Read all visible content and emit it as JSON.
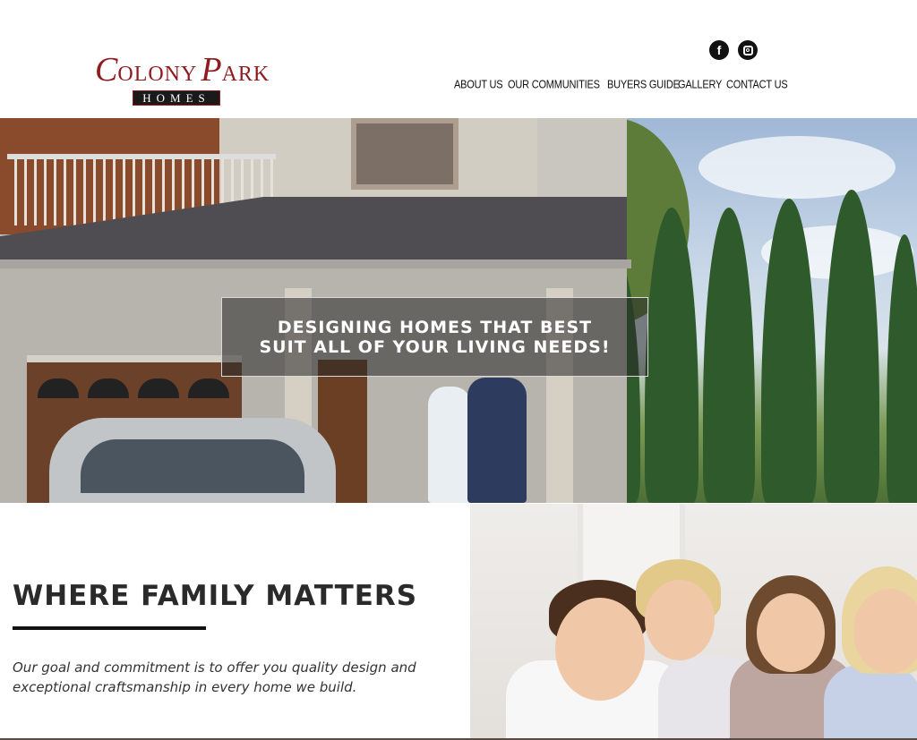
{
  "brand": {
    "logo_line1_big_c": "C",
    "logo_line1_olony": "OLONY",
    "logo_line1_big_p": "P",
    "logo_line1_ark": "ARK",
    "logo_line2": "HOMES",
    "accent_color": "#8e1b1e"
  },
  "social": {
    "facebook_glyph": "f",
    "facebook_icon": "facebook-icon",
    "instagram_icon": "instagram-icon"
  },
  "nav": {
    "items": [
      {
        "label": "ABOUT US"
      },
      {
        "label": "OUR COMMUNITIES"
      },
      {
        "label": "BUYERS GUIDE"
      },
      {
        "label": "GALLERY"
      },
      {
        "label": "CONTACT US"
      }
    ]
  },
  "hero": {
    "line1": "DESIGNING HOMES THAT BEST",
    "line2": "SUIT ALL OF YOUR LIVING NEEDS!"
  },
  "family": {
    "title": "WHERE FAMILY MATTERS",
    "text": "Our goal and commitment is to offer you quality design and exceptional craftsmanship in every home we build."
  }
}
